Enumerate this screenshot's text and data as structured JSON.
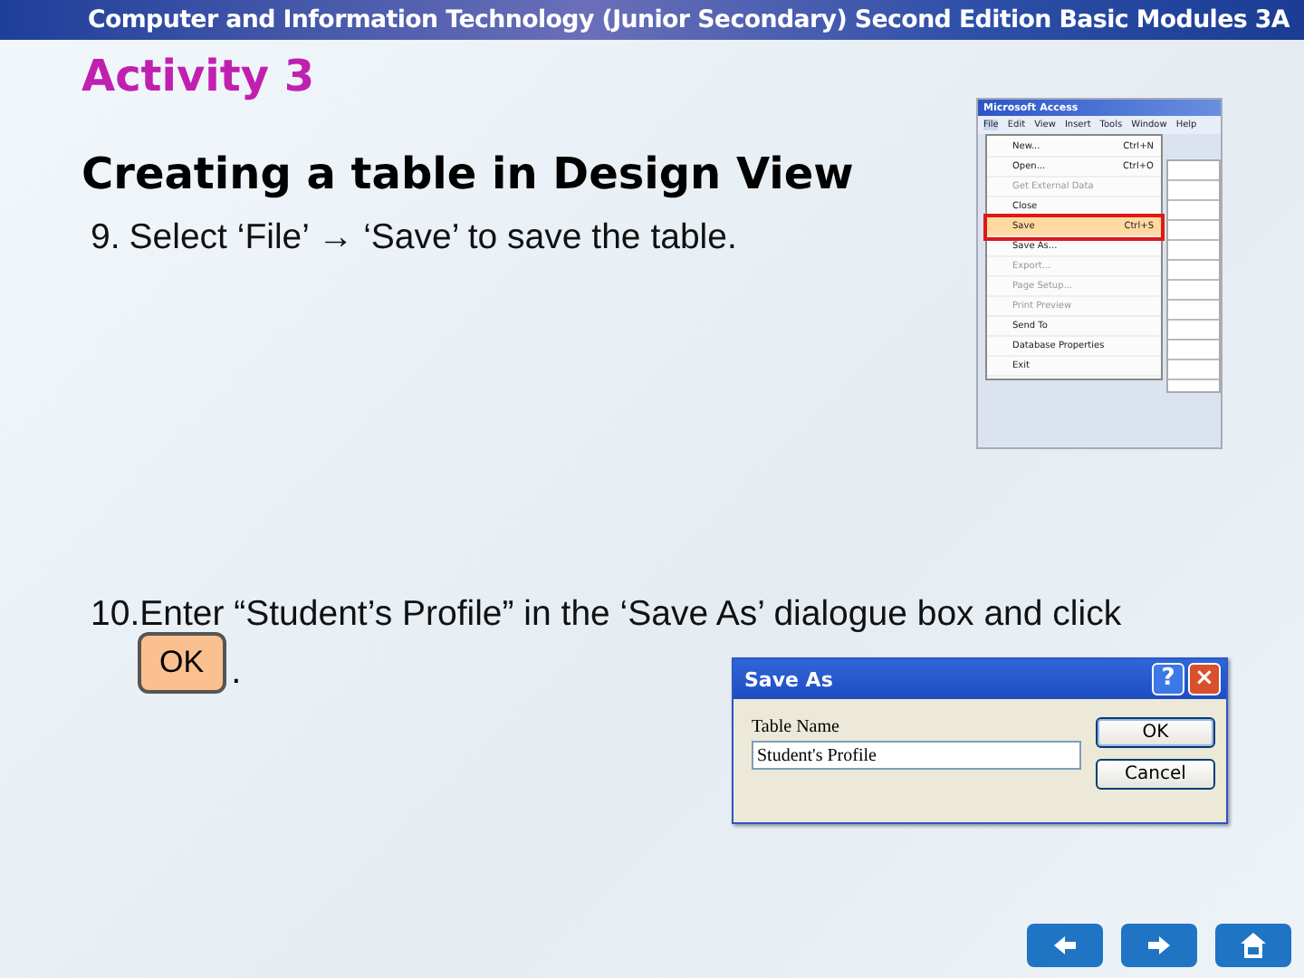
{
  "header": {
    "title": "Computer and Information Technology (Junior Secondary) Second Edition Basic Modules 3A"
  },
  "activity": "Activity 3",
  "heading": "Creating a table in Design View",
  "step_9": {
    "number": "9.",
    "text": "Select ‘File’ → ‘Save’ to save the table."
  },
  "access_window": {
    "title": "Microsoft Access",
    "menu_bar": [
      "File",
      "Edit",
      "View",
      "Insert",
      "Tools",
      "Window",
      "Help"
    ],
    "menu_items": [
      {
        "label": "New...",
        "shortcut": "Ctrl+N",
        "selected": false,
        "disabled": false
      },
      {
        "label": "Open...",
        "shortcut": "Ctrl+O",
        "selected": false,
        "disabled": false
      },
      {
        "label": "Get External Data",
        "selected": false,
        "disabled": true
      },
      {
        "label": "Close",
        "selected": false,
        "disabled": false
      },
      {
        "label": "Save",
        "shortcut": "Ctrl+S",
        "selected": true,
        "disabled": false
      },
      {
        "label": "Save As...",
        "selected": false,
        "disabled": false
      },
      {
        "label": "Export...",
        "selected": false,
        "disabled": true
      },
      {
        "label": "Page Setup...",
        "selected": false,
        "disabled": true
      },
      {
        "label": "Print Preview",
        "selected": false,
        "disabled": true
      },
      {
        "label": "Send To",
        "selected": false,
        "disabled": false
      },
      {
        "label": "Database Properties",
        "selected": false,
        "disabled": false
      },
      {
        "label": "Exit",
        "selected": false,
        "disabled": false
      }
    ]
  },
  "step_10": {
    "number": "10.",
    "text": "Enter “Student’s Profile” in the ‘Save As’ dialogue box and click",
    "button": "OK",
    "end": "."
  },
  "save_as_dialog": {
    "title": "Save As",
    "help": "?",
    "close": "×",
    "label": "Table Name",
    "value": "Student's Profile",
    "buttons": [
      "OK",
      "Cancel"
    ]
  }
}
